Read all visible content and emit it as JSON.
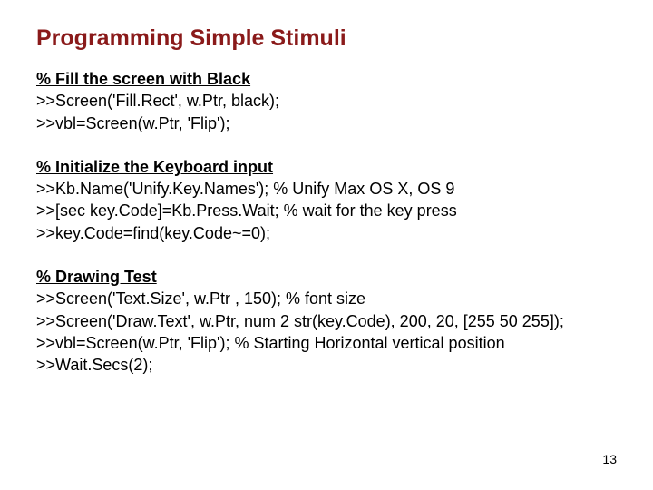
{
  "title": "Programming Simple Stimuli",
  "blocks": [
    {
      "heading": "% Fill the screen with Black",
      "lines": [
        ">>Screen('Fill.Rect', w.Ptr, black);",
        ">>vbl=Screen(w.Ptr, 'Flip');"
      ]
    },
    {
      "heading": "% Initialize the Keyboard input",
      "lines": [
        ">>Kb.Name('Unify.Key.Names'); % Unify Max OS X, OS 9",
        ">>[sec key.Code]=Kb.Press.Wait; % wait for the key press",
        ">>key.Code=find(key.Code~=0);"
      ]
    },
    {
      "heading": "% Drawing Test",
      "lines": [
        ">>Screen('Text.Size', w.Ptr , 150); % font size",
        ">>Screen('Draw.Text', w.Ptr, num 2 str(key.Code), 200, 20, [255 50 255]);",
        ">>vbl=Screen(w.Ptr, 'Flip'); % Starting Horizontal vertical position",
        ">>Wait.Secs(2);"
      ]
    }
  ],
  "page_number": "13"
}
